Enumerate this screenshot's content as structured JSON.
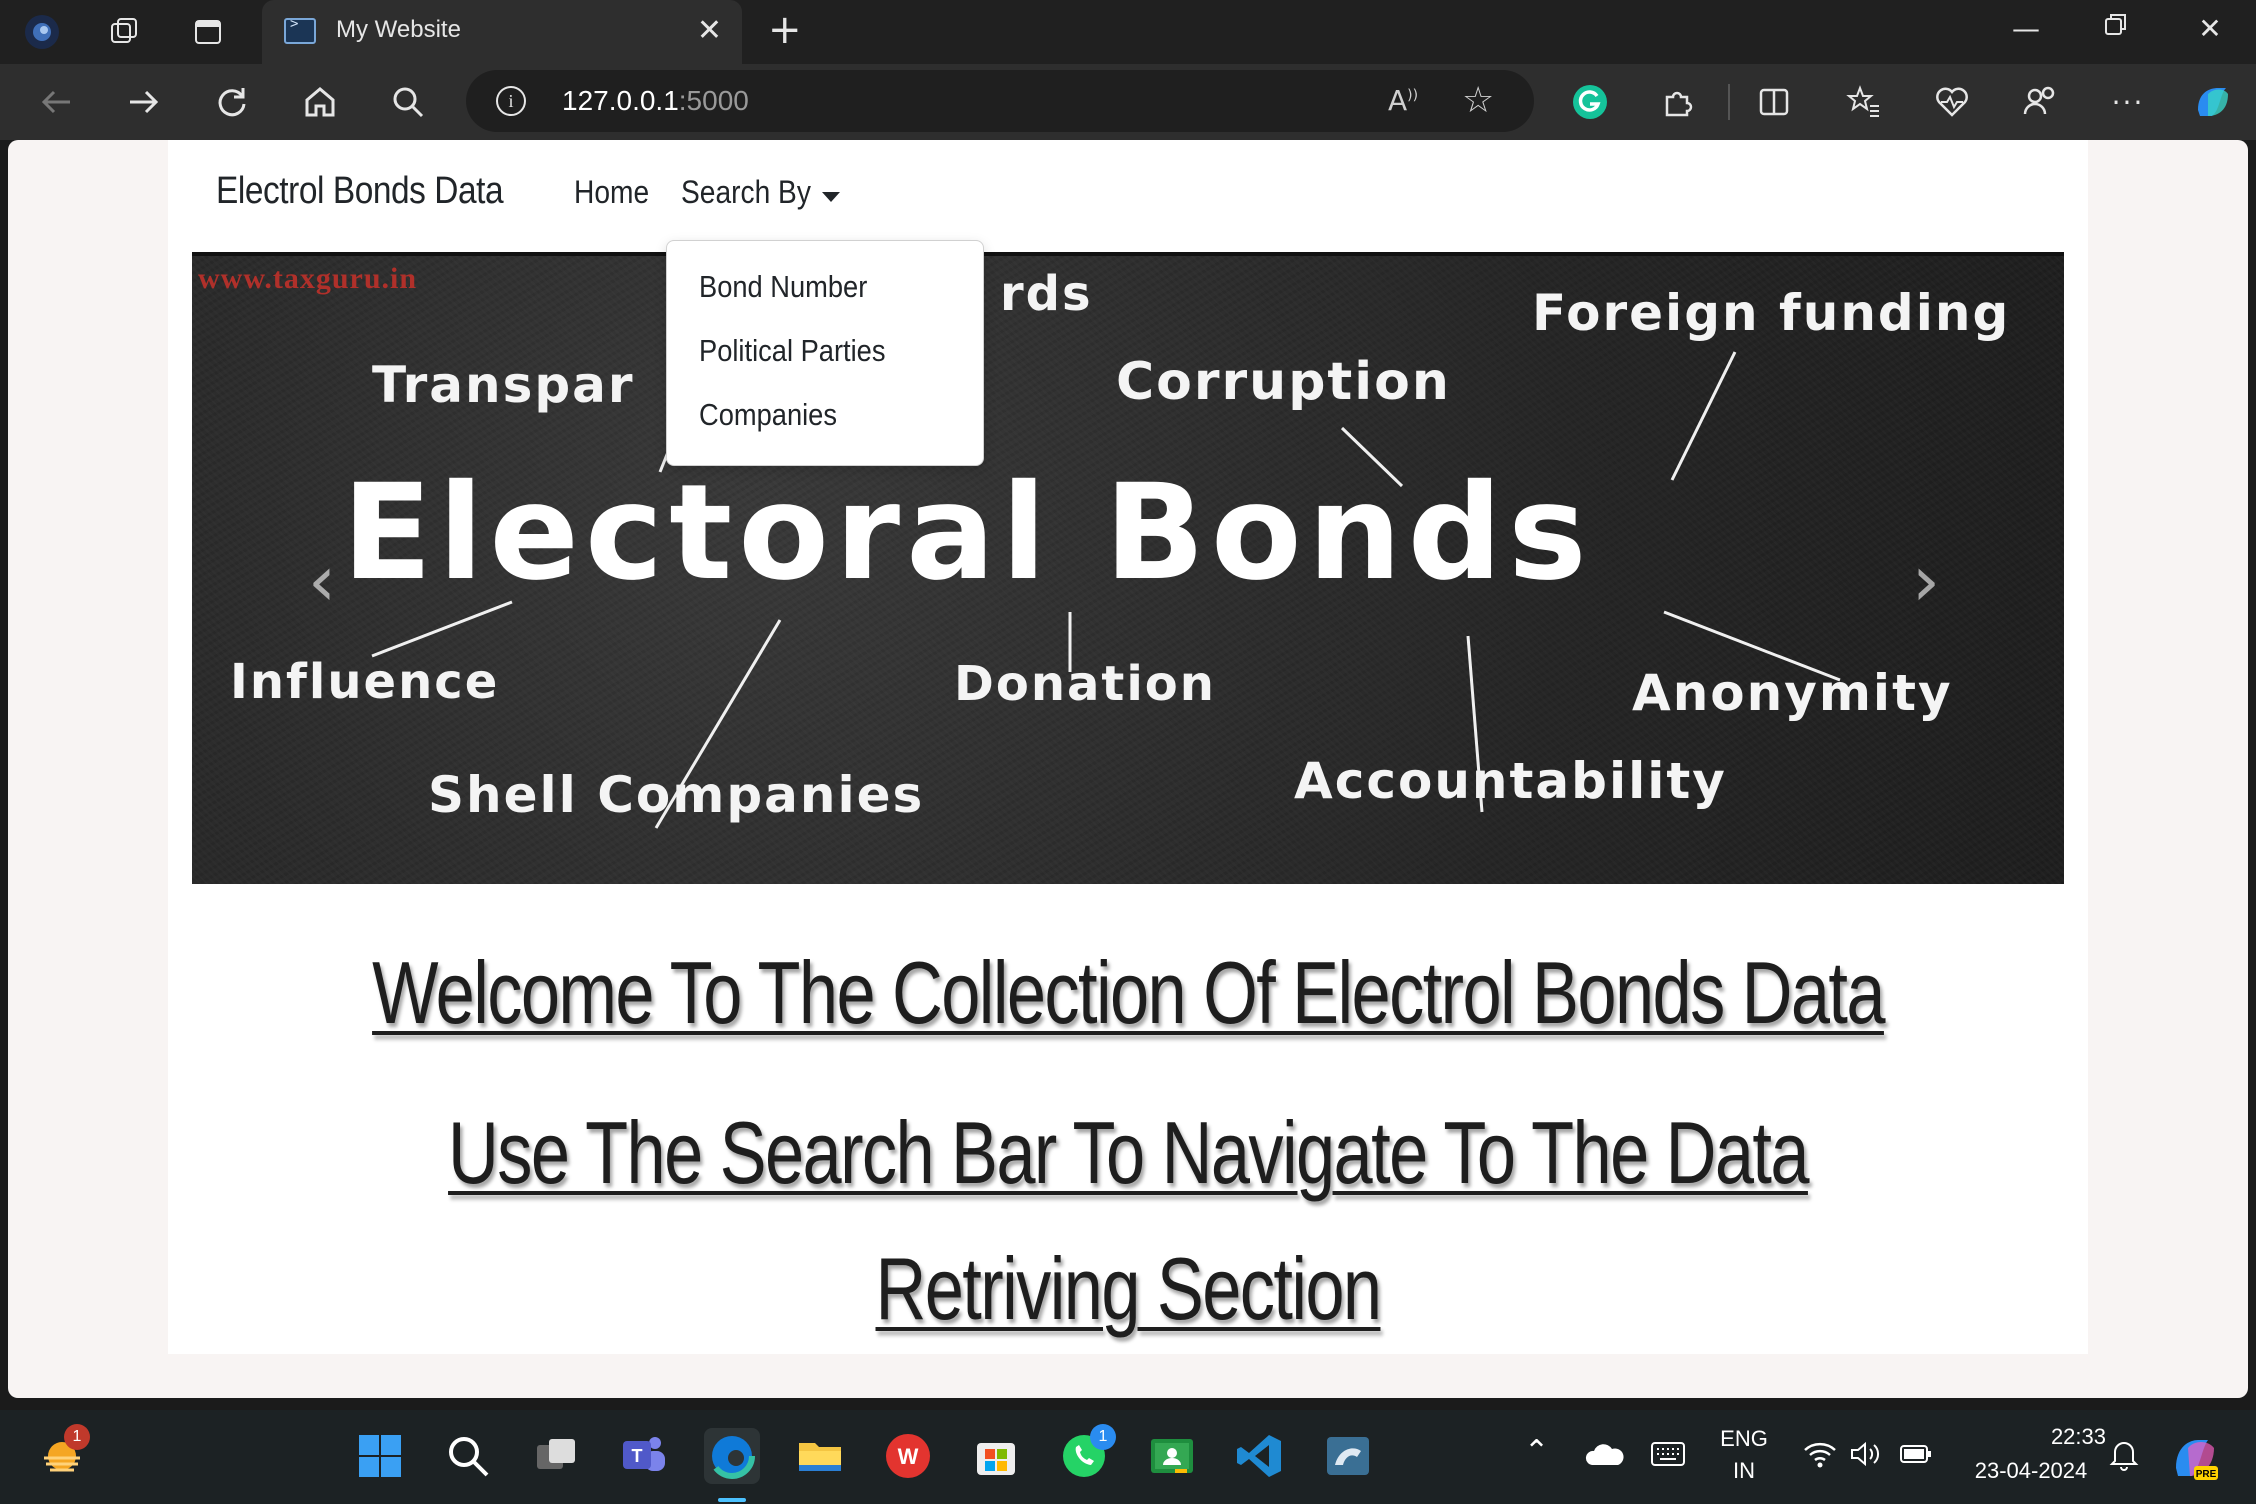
{
  "browser": {
    "tab_title": "My Website",
    "url_host": "127.0.0.1",
    "url_port": ":5000"
  },
  "page": {
    "brand": "Electrol Bonds Data",
    "nav": {
      "home": "Home",
      "search_by": "Search By"
    },
    "dropdown": {
      "items": [
        "Bond Number",
        "Political Parties",
        "Companies"
      ]
    },
    "hero": {
      "watermark": "www.taxguru.in",
      "title": "Electoral Bonds",
      "words": {
        "cards": "rds",
        "transparency": "Transpar",
        "corruption": "Corruption",
        "foreign": "Foreign funding",
        "influence": "Influence",
        "donation": "Donation",
        "anonymity": "Anonymity",
        "shell": "Shell Companies",
        "accountability": "Accountability"
      }
    },
    "welcome_line1": "Welcome To The Collection Of Electrol Bonds Data",
    "welcome_line2": "Use The Search Bar To Navigate To The Data",
    "welcome_line3": "Retriving Section"
  },
  "taskbar": {
    "widgets_badge": "1",
    "whatsapp_badge": "1",
    "lang_top": "ENG",
    "lang_bottom": "IN",
    "time": "22:33",
    "date": "23-04-2024"
  }
}
